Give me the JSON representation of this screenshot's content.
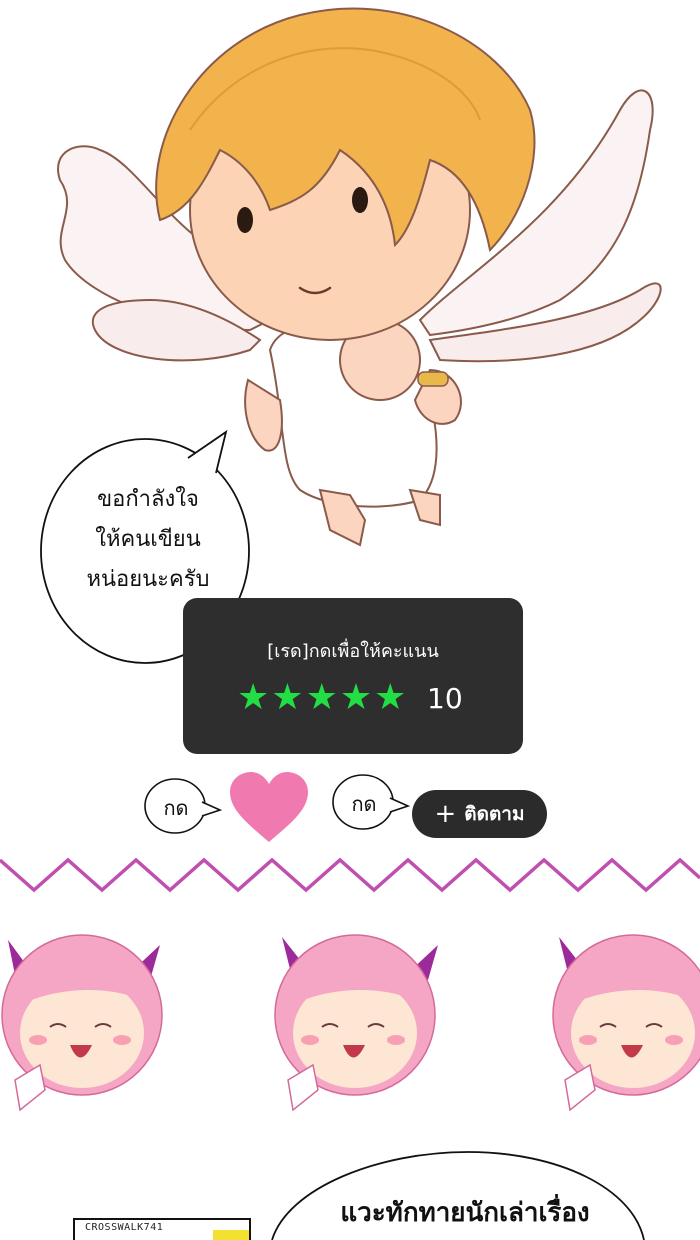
{
  "speech_bubble": {
    "lines": [
      "ขอกำลังใจ",
      "ให้คนเขียน",
      "หน่อยนะครับ"
    ]
  },
  "rating": {
    "title": "[เรด]กดเพื่อให้คะแนน",
    "stars": [
      "★",
      "★",
      "★",
      "★",
      "★"
    ],
    "score": "10",
    "star_color": "#22dd44"
  },
  "actions": {
    "like_prompt": "กด",
    "follow_prompt": "กด",
    "follow_label": "ติดตาม",
    "follow_plus": "+",
    "heart_color": "#f07ab0"
  },
  "footer": {
    "stamp_text": "CROSSWALK741",
    "greeting": "แวะทักทายนักเล่าเรื่อง"
  }
}
